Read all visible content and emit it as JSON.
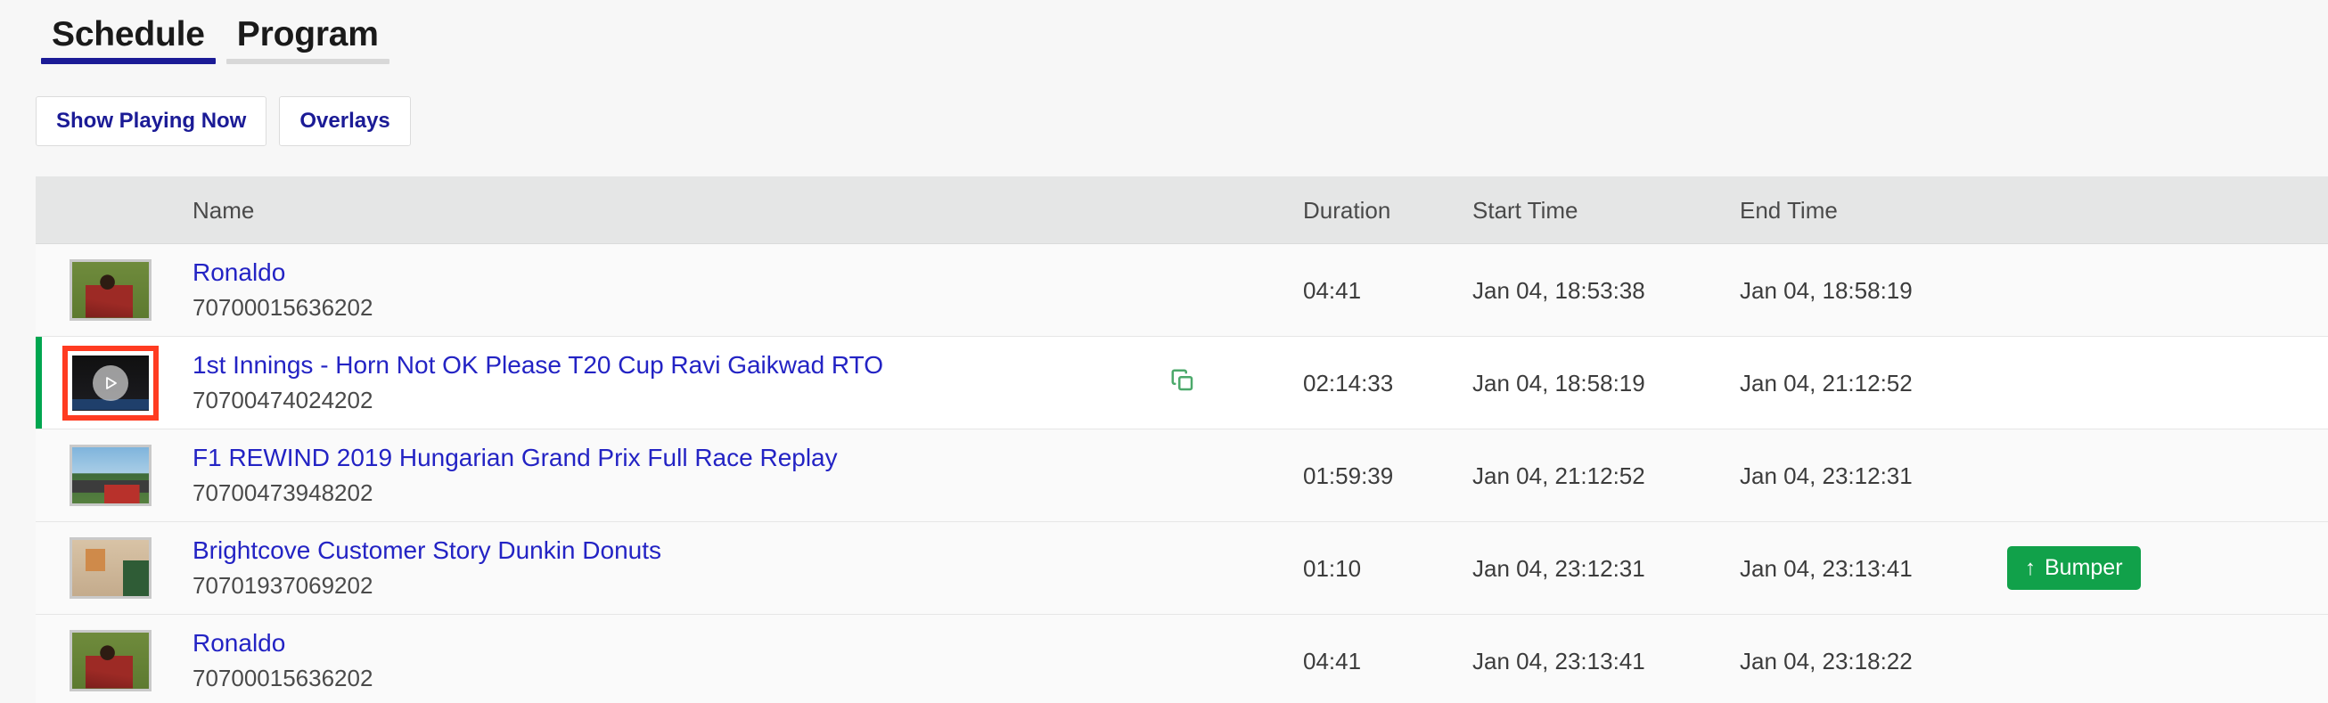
{
  "tabs": [
    {
      "label": "Schedule",
      "active": true
    },
    {
      "label": "Program",
      "active": false
    }
  ],
  "toolbar": {
    "show_playing_now_label": "Show Playing Now",
    "overlays_label": "Overlays"
  },
  "table": {
    "columns": {
      "name": "Name",
      "duration": "Duration",
      "start_time": "Start Time",
      "end_time": "End Time"
    },
    "rows": [
      {
        "title": "Ronaldo",
        "id": "70700015636202",
        "duration": "04:41",
        "start_time": "Jan 04, 18:53:38",
        "end_time": "Jan 04, 18:58:19",
        "badge": "",
        "thumb": "ronaldo",
        "current": false,
        "selected": false,
        "copy_icon": false
      },
      {
        "title": "1st Innings - Horn Not OK Please T20 Cup Ravi Gaikwad RTO",
        "id": "70700474024202",
        "duration": "02:14:33",
        "start_time": "Jan 04, 18:58:19",
        "end_time": "Jan 04, 21:12:52",
        "badge": "",
        "thumb": "cricket",
        "current": true,
        "selected": true,
        "copy_icon": true
      },
      {
        "title": "F1 REWIND 2019 Hungarian Grand Prix Full Race Replay",
        "id": "70700473948202",
        "duration": "01:59:39",
        "start_time": "Jan 04, 21:12:52",
        "end_time": "Jan 04, 23:12:31",
        "badge": "",
        "thumb": "f1",
        "current": false,
        "selected": false,
        "copy_icon": false
      },
      {
        "title": "Brightcove Customer Story Dunkin Donuts",
        "id": "70701937069202",
        "duration": "01:10",
        "start_time": "Jan 04, 23:12:31",
        "end_time": "Jan 04, 23:13:41",
        "badge": "Bumper",
        "badge_arrow": "↑",
        "thumb": "dunkin",
        "current": false,
        "selected": false,
        "copy_icon": false
      },
      {
        "title": "Ronaldo",
        "id": "70700015636202",
        "duration": "04:41",
        "start_time": "Jan 04, 23:13:41",
        "end_time": "Jan 04, 23:18:22",
        "badge": "",
        "thumb": "ronaldo",
        "current": false,
        "selected": false,
        "copy_icon": false
      }
    ]
  },
  "colors": {
    "active_tab_underline": "#1B1B96",
    "link": "#2323C4",
    "current_row_indicator": "#00A650",
    "selected_thumb_border": "#FF3B21",
    "badge_green": "#11A14A",
    "copy_icon_green": "#4CA96B",
    "page_background": "#F7F7F7",
    "header_background": "#E5E6E6"
  },
  "icons": {
    "play": "play-icon",
    "copy": "copy-icon",
    "badge_arrow": "arrow-up-icon"
  }
}
